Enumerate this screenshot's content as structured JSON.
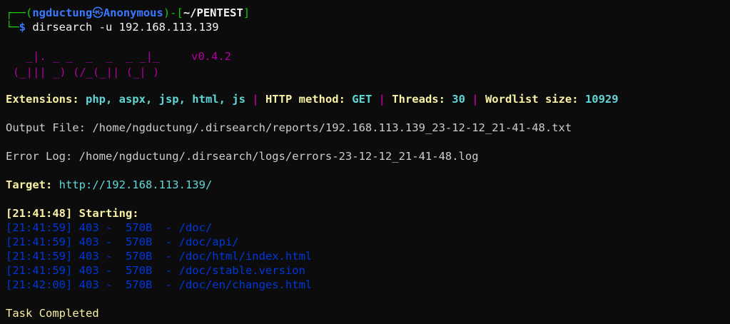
{
  "prompt": {
    "box_top": "┌──(",
    "user": "ngductung",
    "sep": "㉿",
    "host": "Anonymous",
    "mid": ")-[",
    "path": "~/PENTEST",
    "close": "]",
    "box_bottom": "└─",
    "symbol": "$",
    "command": " dirsearch -u 192.168.113.139"
  },
  "banner": {
    "line1": "  _|. _ _  _  _  _ _|_",
    "line2": "(_||| _) (/_(_|| (_| )",
    "version": "v0.4.2"
  },
  "config": {
    "ext_label": "Extensions: ",
    "ext_value": "php, aspx, jsp, html, js",
    "pipe": " | ",
    "method_label": "HTTP method: ",
    "method_value": "GET",
    "threads_label": "Threads: ",
    "threads_value": "30",
    "wordlist_label": "Wordlist size: ",
    "wordlist_value": "10929"
  },
  "output_file": "Output File: /home/ngductung/.dirsearch/reports/192.168.113.139_23-12-12_21-41-48.txt",
  "error_log": "Error Log: /home/ngductung/.dirsearch/logs/errors-23-12-12_21-41-48.log",
  "target": {
    "label": "Target: ",
    "url": "http://192.168.113.139/"
  },
  "starting": "[21:41:48] Starting:",
  "results": [
    "[21:41:59] 403 -  570B  - /doc/",
    "[21:41:59] 403 -  570B  - /doc/api/",
    "[21:41:59] 403 -  570B  - /doc/html/index.html",
    "[21:41:59] 403 -  570B  - /doc/stable.version",
    "[21:42:00] 403 -  570B  - /doc/en/changes.html"
  ],
  "completed": "Task Completed",
  "colors": {
    "background": "#0c0c0c",
    "prompt_green": "#16c60c",
    "prompt_blue": "#3b78ff",
    "label_yellow": "#f9f1a5",
    "value_cyan": "#61d6d6",
    "banner_magenta": "#b4009e",
    "result_blue": "#0037da"
  }
}
